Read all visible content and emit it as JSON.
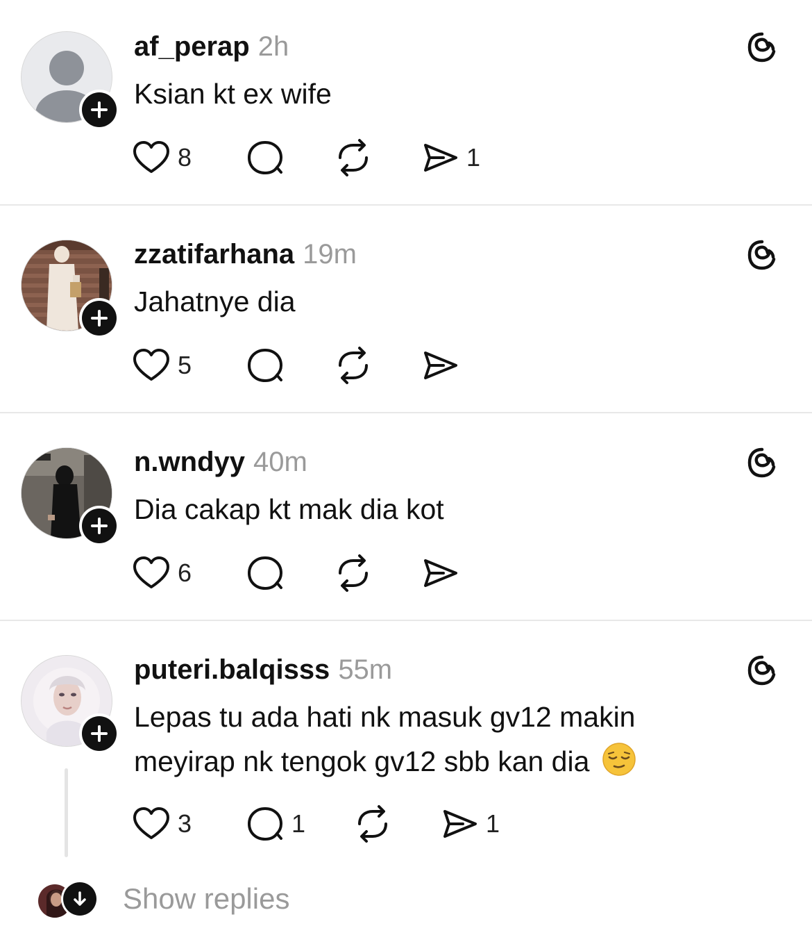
{
  "posts": [
    {
      "username": "af_perap",
      "time": "2h",
      "text": "Ksian kt ex wife",
      "likes": "8",
      "comments": "",
      "reposts": "",
      "shares": "1",
      "avatar": "default-avatar"
    },
    {
      "username": "zzatifarhana",
      "time": "19m",
      "text": "Jahatnye dia",
      "likes": "5",
      "comments": "",
      "reposts": "",
      "shares": "",
      "avatar": "photo-avatar"
    },
    {
      "username": "n.wndyy",
      "time": "40m",
      "text": "Dia cakap kt mak dia kot",
      "likes": "6",
      "comments": "",
      "reposts": "",
      "shares": "",
      "avatar": "photo-avatar"
    },
    {
      "username": "puteri.balqisss",
      "time": "55m",
      "text_line1": "Lepas tu ada hati nk masuk gv12 makin",
      "text_line2": "meyirap nk tengok gv12 sbb kan dia",
      "emoji": "relieved-face-emoji",
      "likes": "3",
      "comments": "1",
      "reposts": "",
      "shares": "1",
      "avatar": "photo-avatar"
    }
  ],
  "show_replies": {
    "label": "Show replies"
  },
  "colors": {
    "text": "#111111",
    "muted": "#9a9a9a",
    "divider": "#e8e8e8"
  }
}
